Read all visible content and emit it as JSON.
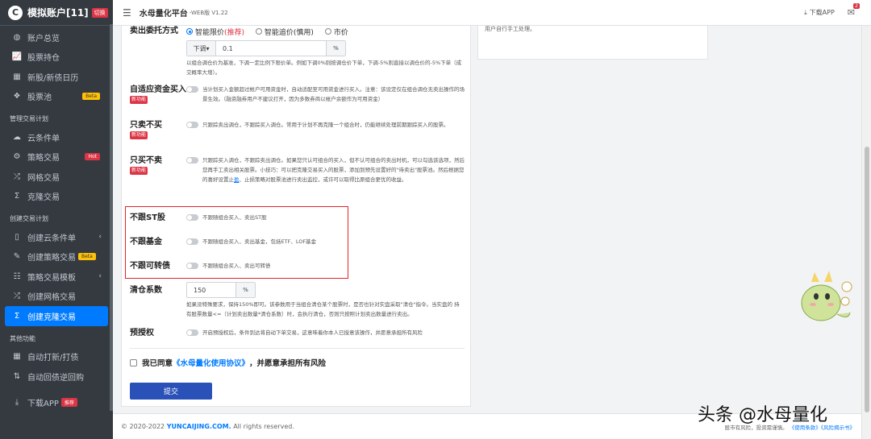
{
  "sidebar": {
    "brand": "模拟账户[11]",
    "brand_badge": "切换",
    "items": [
      {
        "label": "账户总览",
        "icon": "dashboard-icon"
      },
      {
        "label": "股票持仓",
        "icon": "chart-icon"
      },
      {
        "label": "新股/新债日历",
        "icon": "calendar-icon"
      },
      {
        "label": "股票池",
        "icon": "pool-icon",
        "badge": "Beta"
      }
    ],
    "section_manage": "管理交易计划",
    "manage_items": [
      {
        "label": "云条件单",
        "icon": "cloud-icon"
      },
      {
        "label": "策略交易",
        "icon": "strategy-icon",
        "badge": "Hot"
      },
      {
        "label": "网格交易",
        "icon": "shuffle-icon"
      },
      {
        "label": "克隆交易",
        "icon": "clone-icon"
      }
    ],
    "section_create": "创建交易计划",
    "create_items": [
      {
        "label": "创建云条件单",
        "icon": "file-icon"
      },
      {
        "label": "创建策略交易",
        "icon": "magic-icon",
        "badge": "Beta"
      },
      {
        "label": "策略交易模板",
        "icon": "template-icon"
      },
      {
        "label": "创建网格交易",
        "icon": "shuffle-icon"
      },
      {
        "label": "创建克隆交易",
        "icon": "clone-icon"
      }
    ],
    "section_other": "其他功能",
    "other_items": [
      {
        "label": "自动打新/打债",
        "icon": "calendar-icon"
      },
      {
        "label": "自动回债逆回购",
        "icon": "sort-icon"
      }
    ],
    "download": "下载APP",
    "download_badge": "推荐"
  },
  "topbar": {
    "title": "水母量化平台",
    "version": "-WEB版 V1.22",
    "download": "下载APP",
    "mail_count": "2"
  },
  "right_panel": {
    "text": "用户自行手工处理。"
  },
  "form": {
    "sell_mode": {
      "label": "卖出委托方式",
      "options": [
        {
          "label": "智能限价",
          "extra": "(推荐)",
          "selected": true
        },
        {
          "label": "智能追价",
          "extra": "(慎用)",
          "selected": false
        },
        {
          "label": "市价",
          "extra": "",
          "selected": false
        }
      ],
      "prefix": "下调",
      "value": "0.1",
      "suffix": "%",
      "hint": "以组合调仓价为基准，下调一定比例下限价单。例如下调0%则按调仓价下单，下调-5%则直接以调仓价的-5%下单（成交概率大增）。"
    },
    "adaptive": {
      "label": "自适应资金买入",
      "tag": "新功能",
      "desc": "当计划买入金额超过帐户可用资金时，自动适配至可用资金进行买入。注意：该设定仅在组合调仓无卖出操作的场景生效。（融资融券用户不建议打开，因为多数券商以帐户余额作为可用资金）"
    },
    "sell_only": {
      "label": "只卖不买",
      "tag": "新功能",
      "desc": "只跟踪卖出调仓，不跟踪买入调仓。常用于计划不再克隆一个组合时，仍能继续处理前期跟踪买入的股票。"
    },
    "buy_only": {
      "label": "只买不卖",
      "tag": "新功能",
      "desc_a": "只跟踪买入调仓，不跟踪卖出调仓。如果您只认可组合的买入，但不认可组合的卖出时机，可以勾选该选项，然后您再手工卖出相关股票。小技巧：可以把克隆交易买入的股票，添加到预先设置好的\"待卖出\"股票池。然后根据您的喜好设置止",
      "desc_link": "盈",
      "desc_b": "、止损策略对股票池进行卖出监控，或许可以取得比原组合更优的收益。"
    },
    "no_st": {
      "label": "不跟ST股",
      "desc": "不跟随组合买入、卖出ST股"
    },
    "no_fund": {
      "label": "不跟基金",
      "desc": "不跟随组合买入、卖出基金，包括ETF、LOF基金"
    },
    "no_cb": {
      "label": "不跟可转债",
      "desc": "不跟随组合买入、卖出可转债"
    },
    "clear": {
      "label": "清仓系数",
      "value": "150",
      "suffix": "%",
      "hint": "如果没特殊要求，保持150%即可。该参数用于当组合清仓某个股票时，是否也针对实盘采取\"清仓\"指令。当实盘的 持有股票数量<=（计划卖出数量*清仓系数）时，会执行清仓，否则只按照计划卖出数量进行卖出。"
    },
    "preauth": {
      "label": "预授权",
      "desc": "开启预授权后，条件到达将自动下单交易，这意味着你本人已授意该操作，并愿意承担所有风险"
    },
    "agree_pre": "我已同意",
    "agree_link": "《水母量化使用协议》",
    "agree_post": "，并愿意承担所有风险",
    "submit": "提交"
  },
  "footer": {
    "copy_pre": "© 2020-2022",
    "copy_brand": "YUNCAIJING.COM.",
    "copy_post": "All rights reserved.",
    "risk": "股市有风险，投资需谨慎。",
    "link1": "《使用条款》",
    "link2": "《风险揭示书》"
  },
  "watermark": "头条 @水母量化"
}
